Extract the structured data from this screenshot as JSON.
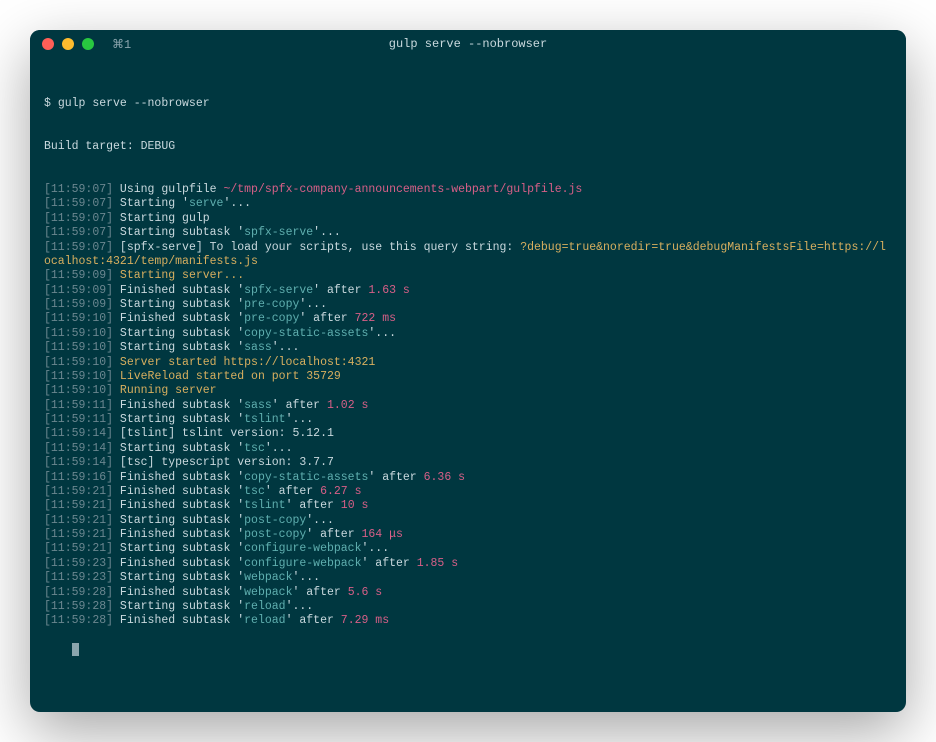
{
  "window": {
    "tab_label": "⌘1",
    "title": "gulp serve --nobrowser"
  },
  "prompt": {
    "symbol": "$ ",
    "command": "gulp serve --nobrowser"
  },
  "build_target": "Build target: DEBUG",
  "lines": [
    {
      "ts": "11:59:07",
      "parts": [
        {
          "cls": "default",
          "txt": " Using gulpfile "
        },
        {
          "cls": "pink",
          "txt": "~/tmp/spfx-company-announcements-webpart/gulpfile.js"
        }
      ]
    },
    {
      "ts": "11:59:07",
      "parts": [
        {
          "cls": "default",
          "txt": " Starting '"
        },
        {
          "cls": "teal",
          "txt": "serve"
        },
        {
          "cls": "default",
          "txt": "'..."
        }
      ]
    },
    {
      "ts": "11:59:07",
      "parts": [
        {
          "cls": "default",
          "txt": " Starting gulp"
        }
      ]
    },
    {
      "ts": "11:59:07",
      "parts": [
        {
          "cls": "default",
          "txt": " Starting subtask '"
        },
        {
          "cls": "teal",
          "txt": "spfx-serve"
        },
        {
          "cls": "default",
          "txt": "'..."
        }
      ]
    },
    {
      "ts": "11:59:07",
      "wrap": true,
      "parts": [
        {
          "cls": "default",
          "txt": " [spfx-serve] To load your scripts, use this query string: "
        },
        {
          "cls": "yellow",
          "txt": "?debug=true&noredir=true&debugManifestsFile=https://localhost:4321/temp/manifests.js"
        }
      ]
    },
    {
      "ts": "11:59:09",
      "parts": [
        {
          "cls": "yellow",
          "txt": " Starting server..."
        }
      ]
    },
    {
      "ts": "11:59:09",
      "parts": [
        {
          "cls": "default",
          "txt": " Finished subtask '"
        },
        {
          "cls": "teal",
          "txt": "spfx-serve"
        },
        {
          "cls": "default",
          "txt": "' after "
        },
        {
          "cls": "pink",
          "txt": "1.63 s"
        }
      ]
    },
    {
      "ts": "11:59:09",
      "parts": [
        {
          "cls": "default",
          "txt": " Starting subtask '"
        },
        {
          "cls": "teal",
          "txt": "pre-copy"
        },
        {
          "cls": "default",
          "txt": "'..."
        }
      ]
    },
    {
      "ts": "11:59:10",
      "parts": [
        {
          "cls": "default",
          "txt": " Finished subtask '"
        },
        {
          "cls": "teal",
          "txt": "pre-copy"
        },
        {
          "cls": "default",
          "txt": "' after "
        },
        {
          "cls": "pink",
          "txt": "722 ms"
        }
      ]
    },
    {
      "ts": "11:59:10",
      "parts": [
        {
          "cls": "default",
          "txt": " Starting subtask '"
        },
        {
          "cls": "teal",
          "txt": "copy-static-assets"
        },
        {
          "cls": "default",
          "txt": "'..."
        }
      ]
    },
    {
      "ts": "11:59:10",
      "parts": [
        {
          "cls": "default",
          "txt": " Starting subtask '"
        },
        {
          "cls": "teal",
          "txt": "sass"
        },
        {
          "cls": "default",
          "txt": "'..."
        }
      ]
    },
    {
      "ts": "11:59:10",
      "parts": [
        {
          "cls": "yellow",
          "txt": " Server started https://localhost:4321"
        }
      ]
    },
    {
      "ts": "11:59:10",
      "parts": [
        {
          "cls": "yellow",
          "txt": " LiveReload started on port 35729"
        }
      ]
    },
    {
      "ts": "11:59:10",
      "parts": [
        {
          "cls": "yellow",
          "txt": " Running server"
        }
      ]
    },
    {
      "ts": "11:59:11",
      "parts": [
        {
          "cls": "default",
          "txt": " Finished subtask '"
        },
        {
          "cls": "teal",
          "txt": "sass"
        },
        {
          "cls": "default",
          "txt": "' after "
        },
        {
          "cls": "pink",
          "txt": "1.02 s"
        }
      ]
    },
    {
      "ts": "11:59:11",
      "parts": [
        {
          "cls": "default",
          "txt": " Starting subtask '"
        },
        {
          "cls": "teal",
          "txt": "tslint"
        },
        {
          "cls": "default",
          "txt": "'..."
        }
      ]
    },
    {
      "ts": "11:59:14",
      "parts": [
        {
          "cls": "default",
          "txt": " [tslint] tslint version: 5.12.1"
        }
      ]
    },
    {
      "ts": "11:59:14",
      "parts": [
        {
          "cls": "default",
          "txt": " Starting subtask '"
        },
        {
          "cls": "teal",
          "txt": "tsc"
        },
        {
          "cls": "default",
          "txt": "'..."
        }
      ]
    },
    {
      "ts": "11:59:14",
      "parts": [
        {
          "cls": "default",
          "txt": " [tsc] typescript version: 3.7.7"
        }
      ]
    },
    {
      "ts": "11:59:16",
      "parts": [
        {
          "cls": "default",
          "txt": " Finished subtask '"
        },
        {
          "cls": "teal",
          "txt": "copy-static-assets"
        },
        {
          "cls": "default",
          "txt": "' after "
        },
        {
          "cls": "pink",
          "txt": "6.36 s"
        }
      ]
    },
    {
      "ts": "11:59:21",
      "parts": [
        {
          "cls": "default",
          "txt": " Finished subtask '"
        },
        {
          "cls": "teal",
          "txt": "tsc"
        },
        {
          "cls": "default",
          "txt": "' after "
        },
        {
          "cls": "pink",
          "txt": "6.27 s"
        }
      ]
    },
    {
      "ts": "11:59:21",
      "parts": [
        {
          "cls": "default",
          "txt": " Finished subtask '"
        },
        {
          "cls": "teal",
          "txt": "tslint"
        },
        {
          "cls": "default",
          "txt": "' after "
        },
        {
          "cls": "pink",
          "txt": "10 s"
        }
      ]
    },
    {
      "ts": "11:59:21",
      "parts": [
        {
          "cls": "default",
          "txt": " Starting subtask '"
        },
        {
          "cls": "teal",
          "txt": "post-copy"
        },
        {
          "cls": "default",
          "txt": "'..."
        }
      ]
    },
    {
      "ts": "11:59:21",
      "parts": [
        {
          "cls": "default",
          "txt": " Finished subtask '"
        },
        {
          "cls": "teal",
          "txt": "post-copy"
        },
        {
          "cls": "default",
          "txt": "' after "
        },
        {
          "cls": "pink",
          "txt": "164 μs"
        }
      ]
    },
    {
      "ts": "11:59:21",
      "parts": [
        {
          "cls": "default",
          "txt": " Starting subtask '"
        },
        {
          "cls": "teal",
          "txt": "configure-webpack"
        },
        {
          "cls": "default",
          "txt": "'..."
        }
      ]
    },
    {
      "ts": "11:59:23",
      "parts": [
        {
          "cls": "default",
          "txt": " Finished subtask '"
        },
        {
          "cls": "teal",
          "txt": "configure-webpack"
        },
        {
          "cls": "default",
          "txt": "' after "
        },
        {
          "cls": "pink",
          "txt": "1.85 s"
        }
      ]
    },
    {
      "ts": "11:59:23",
      "parts": [
        {
          "cls": "default",
          "txt": " Starting subtask '"
        },
        {
          "cls": "teal",
          "txt": "webpack"
        },
        {
          "cls": "default",
          "txt": "'..."
        }
      ]
    },
    {
      "ts": "11:59:28",
      "parts": [
        {
          "cls": "default",
          "txt": " Finished subtask '"
        },
        {
          "cls": "teal",
          "txt": "webpack"
        },
        {
          "cls": "default",
          "txt": "' after "
        },
        {
          "cls": "pink",
          "txt": "5.6 s"
        }
      ]
    },
    {
      "ts": "11:59:28",
      "parts": [
        {
          "cls": "default",
          "txt": " Starting subtask '"
        },
        {
          "cls": "teal",
          "txt": "reload"
        },
        {
          "cls": "default",
          "txt": "'..."
        }
      ]
    },
    {
      "ts": "11:59:28",
      "parts": [
        {
          "cls": "default",
          "txt": " Finished subtask '"
        },
        {
          "cls": "teal",
          "txt": "reload"
        },
        {
          "cls": "default",
          "txt": "' after "
        },
        {
          "cls": "pink",
          "txt": "7.29 ms"
        }
      ]
    }
  ]
}
